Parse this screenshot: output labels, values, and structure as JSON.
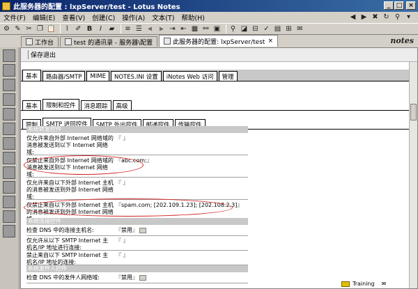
{
  "window": {
    "title": "此服务器的配置 : lxpServer/test - Lotus Notes"
  },
  "menu": [
    "文件(F)",
    "编辑(E)",
    "查看(V)",
    "创建(C)",
    "操作(A)",
    "文本(T)",
    "帮助(H)"
  ],
  "tabs": [
    {
      "label": "工作台"
    },
    {
      "label": "test 的通讯录 - 服务器\\配置"
    },
    {
      "label": "此服务器的配置: lxpServer/test"
    }
  ],
  "brand": "notes",
  "action_bar": {
    "save_close": "保存退出"
  },
  "main_tabs": [
    "基本",
    "路由器/SMTP",
    "MIME",
    "NOTES.INI 设置",
    "iNotes Web 访问",
    "管理"
  ],
  "sub_tabs": [
    "基本",
    "限制和控件",
    "消息跟踪",
    "高级"
  ],
  "sub_sub_tabs": [
    "限制",
    "SMTP 进回控件",
    "SMTP 外出控件",
    "邮递控件",
    "传输控件"
  ],
  "sections": {
    "inbound": "系统转发控件",
    "smtp": "系统连接控件",
    "sender": "系统发件人控件"
  },
  "fields": {
    "allow_internet_label": "仅允许来自外部 Internet 网络域的消息被发送到以下 Internet 网络域:",
    "deny_internet_label": "仅禁止来自外部 Internet 网络域的消息被发送到以下 Internet 网络域:",
    "deny_internet_value": "abc.com;",
    "allow_host_label": "仅允许来自以下外部 Internet 主机的消息被发送到外部 Internet 网络域:",
    "deny_host_label": "仅禁止来自以下外部 Internet 主机的消息被发送到外部 Internet 网络域:",
    "deny_host_value": "spam.com; [202.109.1.23]; [202.108.2.3]",
    "dns_conn_label": "检查 DNS 中的连接主机名:",
    "dns_conn_value": "禁用",
    "allow_smtp_label": "仅允许从以下 SMTP Internet 主机名/IP 地址进行连接:",
    "deny_smtp_label": "禁止来自以下 SMTP Internet 主机名/IP 地址的连接:",
    "dns_sender_label": "检查 DNS 中的发件人网络域:",
    "dns_sender_value": "禁用"
  },
  "status": {
    "location": "Training"
  }
}
